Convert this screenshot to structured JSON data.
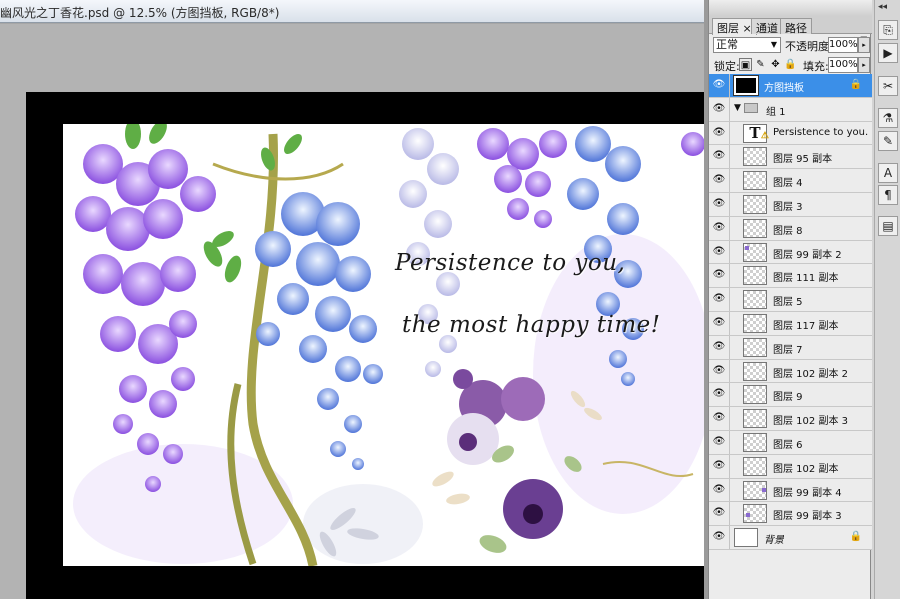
{
  "document": {
    "title": "幽风光之丁香花.psd @ 12.5% (方图挡板, RGB/8*)"
  },
  "artwork": {
    "line1": "Persistence to you,",
    "line2": "the most happy time!"
  },
  "panel": {
    "tabs": [
      {
        "label": "图层",
        "close": "×"
      },
      {
        "label": "通道"
      },
      {
        "label": "路径"
      }
    ],
    "menu_icon": "▸≡",
    "blend_mode": "正常",
    "opacity_label": "不透明度:",
    "opacity_value": "100%",
    "lock_label": "锁定:",
    "fill_label": "填充:",
    "fill_value": "100%",
    "lock_icons": [
      "transparency-lock-icon",
      "brush-lock-icon",
      "move-lock-icon",
      "padlock-icon"
    ],
    "layers": [
      {
        "name": "方图挡板",
        "kind": "black",
        "selected": true,
        "locked": true
      },
      {
        "name": "组 1",
        "kind": "group"
      },
      {
        "name": "Persistence to you...",
        "kind": "text",
        "thumb": "T",
        "warning": "⚠"
      },
      {
        "name": "图层 95 副本",
        "kind": "pixel"
      },
      {
        "name": "图层 4",
        "kind": "pixel"
      },
      {
        "name": "图层 3",
        "kind": "pixel"
      },
      {
        "name": "图层 8",
        "kind": "pixel"
      },
      {
        "name": "图层 99 副本 2",
        "kind": "pixel"
      },
      {
        "name": "图层 111 副本",
        "kind": "pixel"
      },
      {
        "name": "图层 5",
        "kind": "pixel"
      },
      {
        "name": "图层 117 副本",
        "kind": "pixel"
      },
      {
        "name": "图层 7",
        "kind": "pixel"
      },
      {
        "name": "图层 102 副本 2",
        "kind": "pixel"
      },
      {
        "name": "图层 9",
        "kind": "pixel"
      },
      {
        "name": "图层 102 副本 3",
        "kind": "pixel"
      },
      {
        "name": "图层 6",
        "kind": "pixel"
      },
      {
        "name": "图层 102 副本",
        "kind": "pixel"
      },
      {
        "name": "图层 99 副本 4",
        "kind": "pixel"
      },
      {
        "name": "图层 99 副本 3",
        "kind": "pixel"
      },
      {
        "name": "背景",
        "kind": "background",
        "locked": true
      }
    ]
  },
  "toolstrip": {
    "buttons": [
      "history-icon",
      "actions-play-icon",
      "brushes-icon",
      "clone-source-icon",
      "tool-presets-icon",
      "character-icon",
      "paragraph-icon",
      "layer-comps-icon"
    ],
    "glyphs": [
      "⎘",
      "▶",
      "✂",
      "⚗",
      "✎",
      "A",
      "¶",
      "▤"
    ]
  },
  "colors": {
    "selection": "#3b8fe8",
    "canvas_frame": "#000000",
    "wisteria_purple": "#9b6be0",
    "wisteria_blue": "#5a86e0"
  }
}
